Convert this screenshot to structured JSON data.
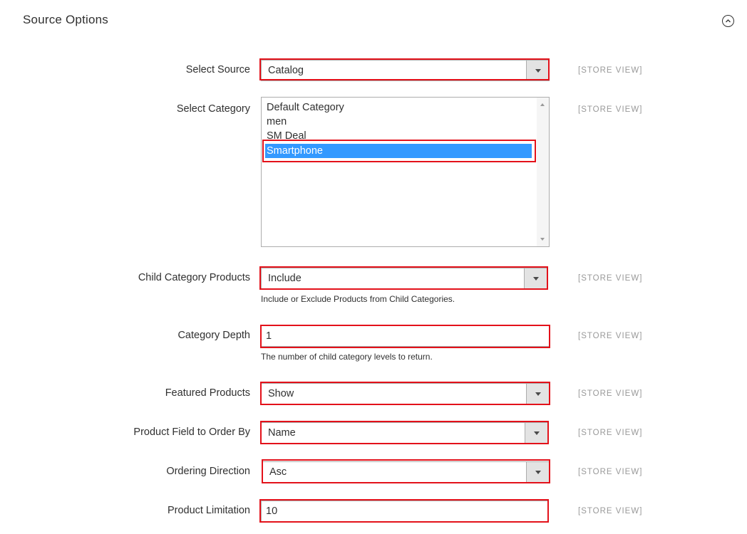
{
  "section": {
    "title": "Source Options",
    "collapse_icon": "chevron-up-circle-icon"
  },
  "scope_label": "[STORE VIEW]",
  "fields": {
    "select_source": {
      "label": "Select Source",
      "value": "Catalog"
    },
    "select_category": {
      "label": "Select Category",
      "options": [
        "Default Category",
        "men",
        "SM Deal",
        "Smartphone"
      ],
      "selected": "Smartphone"
    },
    "child_category_products": {
      "label": "Child Category Products",
      "value": "Include",
      "note": "Include or Exclude Products from Child Categories."
    },
    "category_depth": {
      "label": "Category Depth",
      "value": "1",
      "note": "The number of child category levels to return."
    },
    "featured_products": {
      "label": "Featured Products",
      "value": "Show"
    },
    "product_field_order_by": {
      "label": "Product Field to Order By",
      "value": "Name"
    },
    "ordering_direction": {
      "label": "Ordering Direction",
      "value": "Asc"
    },
    "product_limitation": {
      "label": "Product Limitation",
      "value": "10"
    }
  },
  "colors": {
    "highlight": "#e3111a",
    "selection": "#3399ff",
    "scope_text": "#999999"
  }
}
